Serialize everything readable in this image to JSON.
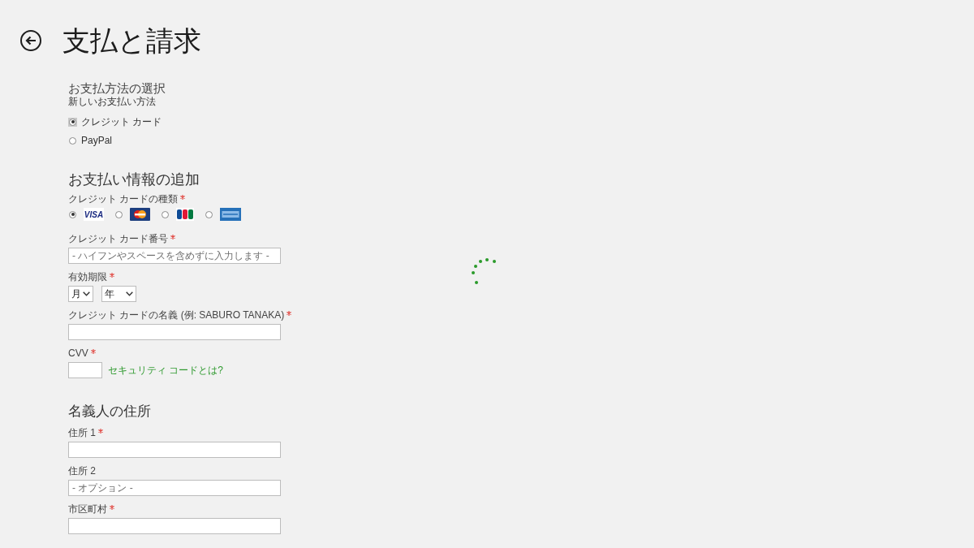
{
  "header": {
    "title": "支払と請求"
  },
  "payment_method": {
    "heading": "お支払方法の選択",
    "subheading": "新しいお支払い方法",
    "options": [
      {
        "label": "クレジット カード",
        "selected": true,
        "focused": true
      },
      {
        "label": "PayPal",
        "selected": false,
        "focused": false
      }
    ]
  },
  "payment_info": {
    "heading": "お支払い情報の追加",
    "card_type": {
      "label": "クレジット カードの種類",
      "required": true,
      "options": [
        {
          "kind": "visa",
          "logo_text": "VISA",
          "selected": true
        },
        {
          "kind": "mastercard",
          "selected": false
        },
        {
          "kind": "jcb",
          "selected": false
        },
        {
          "kind": "amex",
          "selected": false
        }
      ]
    },
    "fields": [
      {
        "kind": "text",
        "label": "クレジット カード番号",
        "required": true,
        "placeholder": "- ハイフンやスペースを含めずに入力します -"
      },
      {
        "kind": "selects",
        "label": "有効期限",
        "required": true,
        "selects": [
          {
            "value": "月"
          },
          {
            "value": "年"
          }
        ]
      },
      {
        "kind": "text",
        "label": "クレジット カードの名義 (例: SABURO TANAKA)",
        "required": true
      },
      {
        "kind": "cvv",
        "label": "CVV",
        "required": true,
        "link": "セキュリティ コードとは?"
      }
    ]
  },
  "billing_address": {
    "heading": "名義人の住所",
    "fields": [
      {
        "kind": "text",
        "label": "住所 1",
        "required": true
      },
      {
        "kind": "text",
        "label": "住所 2",
        "required": false,
        "placeholder": "- オプション -"
      },
      {
        "kind": "text",
        "label": "市区町村",
        "required": true
      }
    ]
  }
}
